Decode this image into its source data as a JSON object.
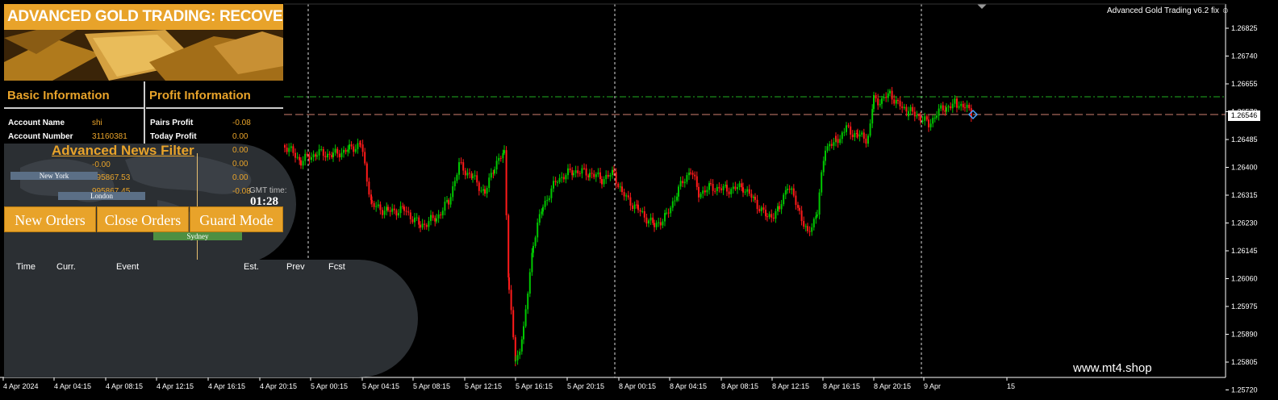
{
  "ea_label": "Advanced Gold Trading v6.2 fix",
  "banner": {
    "title": "ADVANCED GOLD TRADING: RECOVERY"
  },
  "basic": {
    "header": "Basic Information",
    "rows": [
      {
        "label": "Account Name",
        "value": "shi"
      },
      {
        "label": "Account Number",
        "value": "31160381"
      }
    ],
    "partial_values": [
      "-0.00",
      "995867.53",
      "995867.45"
    ]
  },
  "profit": {
    "header": "Profit Information",
    "rows": [
      {
        "label": "Pairs Profit",
        "value": "-0.08"
      },
      {
        "label": "Today Profit",
        "value": "0.00"
      }
    ],
    "values": [
      "0.00",
      "0.00",
      "0.00",
      "-0.08"
    ]
  },
  "news": {
    "title": "Advanced News Filter",
    "sessions": {
      "ny": "New York",
      "london": "London",
      "sydney": "Sydney"
    },
    "gmt_label": "GMT time:",
    "gmt_time": "01:28",
    "columns": [
      "Time",
      "Curr.",
      "Event",
      "Est.",
      "Prev",
      "Fcst"
    ]
  },
  "buttons": {
    "new_orders": "New Orders",
    "close_orders": "Close Orders",
    "guard_mode": "Guard Mode"
  },
  "watermark": "www.mt4.shop",
  "current_price": "1.26546",
  "price_ticks": [
    "1.26825",
    "1.26740",
    "1.26655",
    "1.26570",
    "1.26485",
    "1.26400",
    "1.26315",
    "1.26230",
    "1.26145",
    "1.26060",
    "1.25975",
    "1.25890",
    "1.25805",
    "1.25720"
  ],
  "time_ticks": [
    "4 Apr 2024",
    "4 Apr 04:15",
    "4 Apr 08:15",
    "4 Apr 12:15",
    "4 Apr 16:15",
    "4 Apr 20:15",
    "5 Apr 00:15",
    "5 Apr 04:15",
    "5 Apr 08:15",
    "5 Apr 12:15",
    "5 Apr 16:15",
    "5 Apr 20:15",
    "8 Apr 00:15",
    "8 Apr 04:15",
    "8 Apr 08:15",
    "8 Apr 12:15",
    "8 Apr 16:15",
    "8 Apr 20:15",
    "9 Apr",
    "15"
  ],
  "colors": {
    "accent": "#e8a32a",
    "bull": "#00c800",
    "bear": "#ff1a1a",
    "panel_gray": "#2b2f33"
  }
}
